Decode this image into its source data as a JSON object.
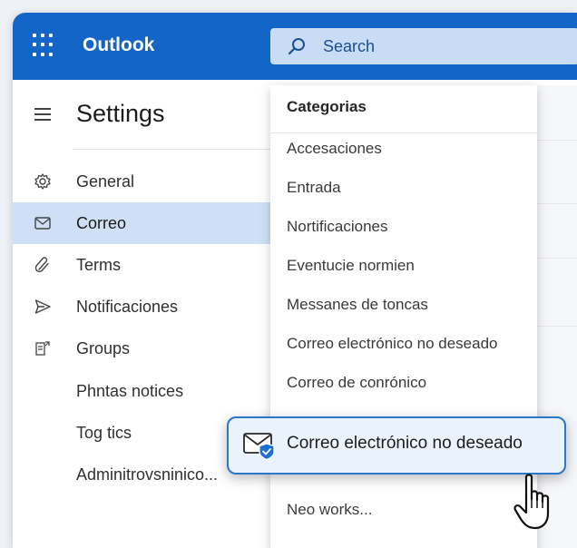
{
  "app": {
    "name": "Outlook"
  },
  "search": {
    "placeholder": "Search"
  },
  "sidebar": {
    "title": "Settings",
    "items": [
      {
        "label": "General",
        "icon": "gear-icon",
        "active": false
      },
      {
        "label": "Correo",
        "icon": "mail-icon",
        "active": true
      },
      {
        "label": "Terms",
        "icon": "paperclip-icon",
        "active": false
      },
      {
        "label": "Notificaciones",
        "icon": "send-icon",
        "active": false
      },
      {
        "label": "Groups",
        "icon": "groups-icon",
        "active": false
      },
      {
        "label": "Phntas notices",
        "icon": "",
        "active": false
      },
      {
        "label": "Tog tics",
        "icon": "",
        "active": false
      },
      {
        "label": "Adminitrovsninico...",
        "icon": "",
        "active": false
      }
    ]
  },
  "dropdown": {
    "header": "Categorias",
    "items": [
      "Accesaciones",
      "Entrada",
      "Nortificaciones",
      "Eventucie normien",
      "Messanes de toncas",
      "Correo electrónico no deseado",
      "Correo de conrónico"
    ],
    "footer_item": "Neo works..."
  },
  "highlight": {
    "label": "Correo electrónico no deseado",
    "icon": "mail-shield-icon"
  },
  "colors": {
    "brand": "#1365c8",
    "active_nav": "#cfe0f6",
    "highlight_border": "#2c77c9"
  }
}
